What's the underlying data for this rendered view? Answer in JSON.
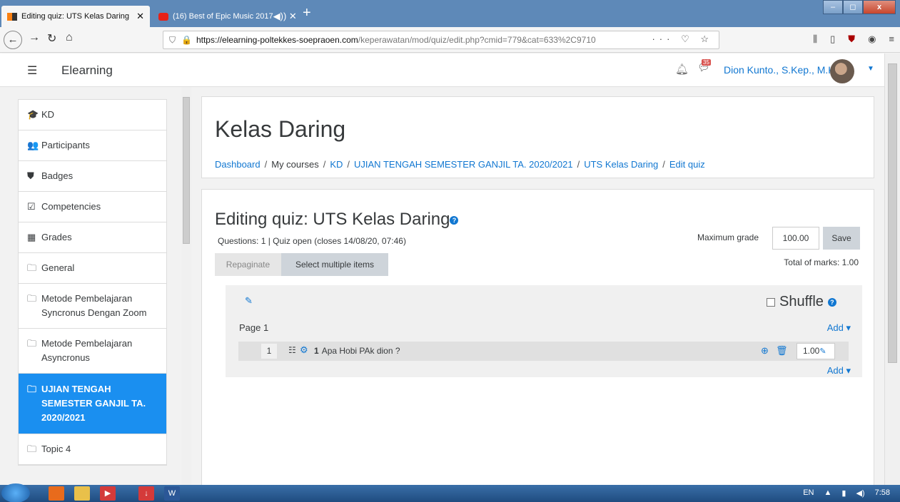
{
  "browser": {
    "tabs": [
      {
        "title": "Editing quiz: UTS Kelas Daring",
        "close": "✕"
      },
      {
        "title": "(16) Best of Epic Music 2017",
        "close": "◀)) ✕"
      }
    ],
    "new_tab": "+",
    "url_host": "https://elearning-poltekkes-soepraoen.com",
    "url_rest": "/keperawatan/mod/quiz/edit.php?cmid=779&cat=633%2C9710",
    "url_actions": "··· ♡ ☆"
  },
  "header": {
    "brand": "Elearning",
    "user_name": "Dion Kunto., S.Kep., M.Kep",
    "messages_count": "35"
  },
  "sidebar": {
    "items": [
      {
        "icon": "🎓",
        "label": "KD"
      },
      {
        "icon": "👥",
        "label": "Participants"
      },
      {
        "icon": "⛊",
        "label": "Badges"
      },
      {
        "icon": "☑",
        "label": "Competencies"
      },
      {
        "icon": "▦",
        "label": "Grades"
      },
      {
        "icon": "🗀",
        "label": "General"
      },
      {
        "icon": "🗀",
        "label": "Metode Pembelajaran Syncronus Dengan Zoom"
      },
      {
        "icon": "🗀",
        "label": "Metode Pembelajaran Asyncronus"
      },
      {
        "icon": "🗀",
        "label": "UJIAN TENGAH SEMESTER GANJIL TA. 2020/2021"
      },
      {
        "icon": "🗀",
        "label": "Topic 4"
      }
    ]
  },
  "page": {
    "title": "Kelas Daring",
    "breadcrumb": [
      "Dashboard",
      "My courses",
      "KD",
      "UJIAN TENGAH SEMESTER GANJIL TA. 2020/2021",
      "UTS Kelas Daring",
      "Edit quiz"
    ],
    "breadcrumb_sep": "/"
  },
  "quiz": {
    "heading": "Editing quiz: UTS Kelas Daring",
    "info": "Questions: 1 | Quiz open (closes 14/08/20, 07:46)",
    "repaginate": "Repaginate",
    "select_multiple": "Select multiple items",
    "max_grade_label": "Maximum grade",
    "max_grade_value": "100.00",
    "save": "Save",
    "total_marks": "Total of marks: 1.00",
    "shuffle": "Shuffle",
    "page_label": "Page 1",
    "add": "Add ▾",
    "question": {
      "slot": "1",
      "number": "1",
      "text": "Apa Hobi PAk dion ?",
      "mark": "1.00"
    }
  },
  "taskbar": {
    "lang": "EN",
    "time": "7:58"
  }
}
